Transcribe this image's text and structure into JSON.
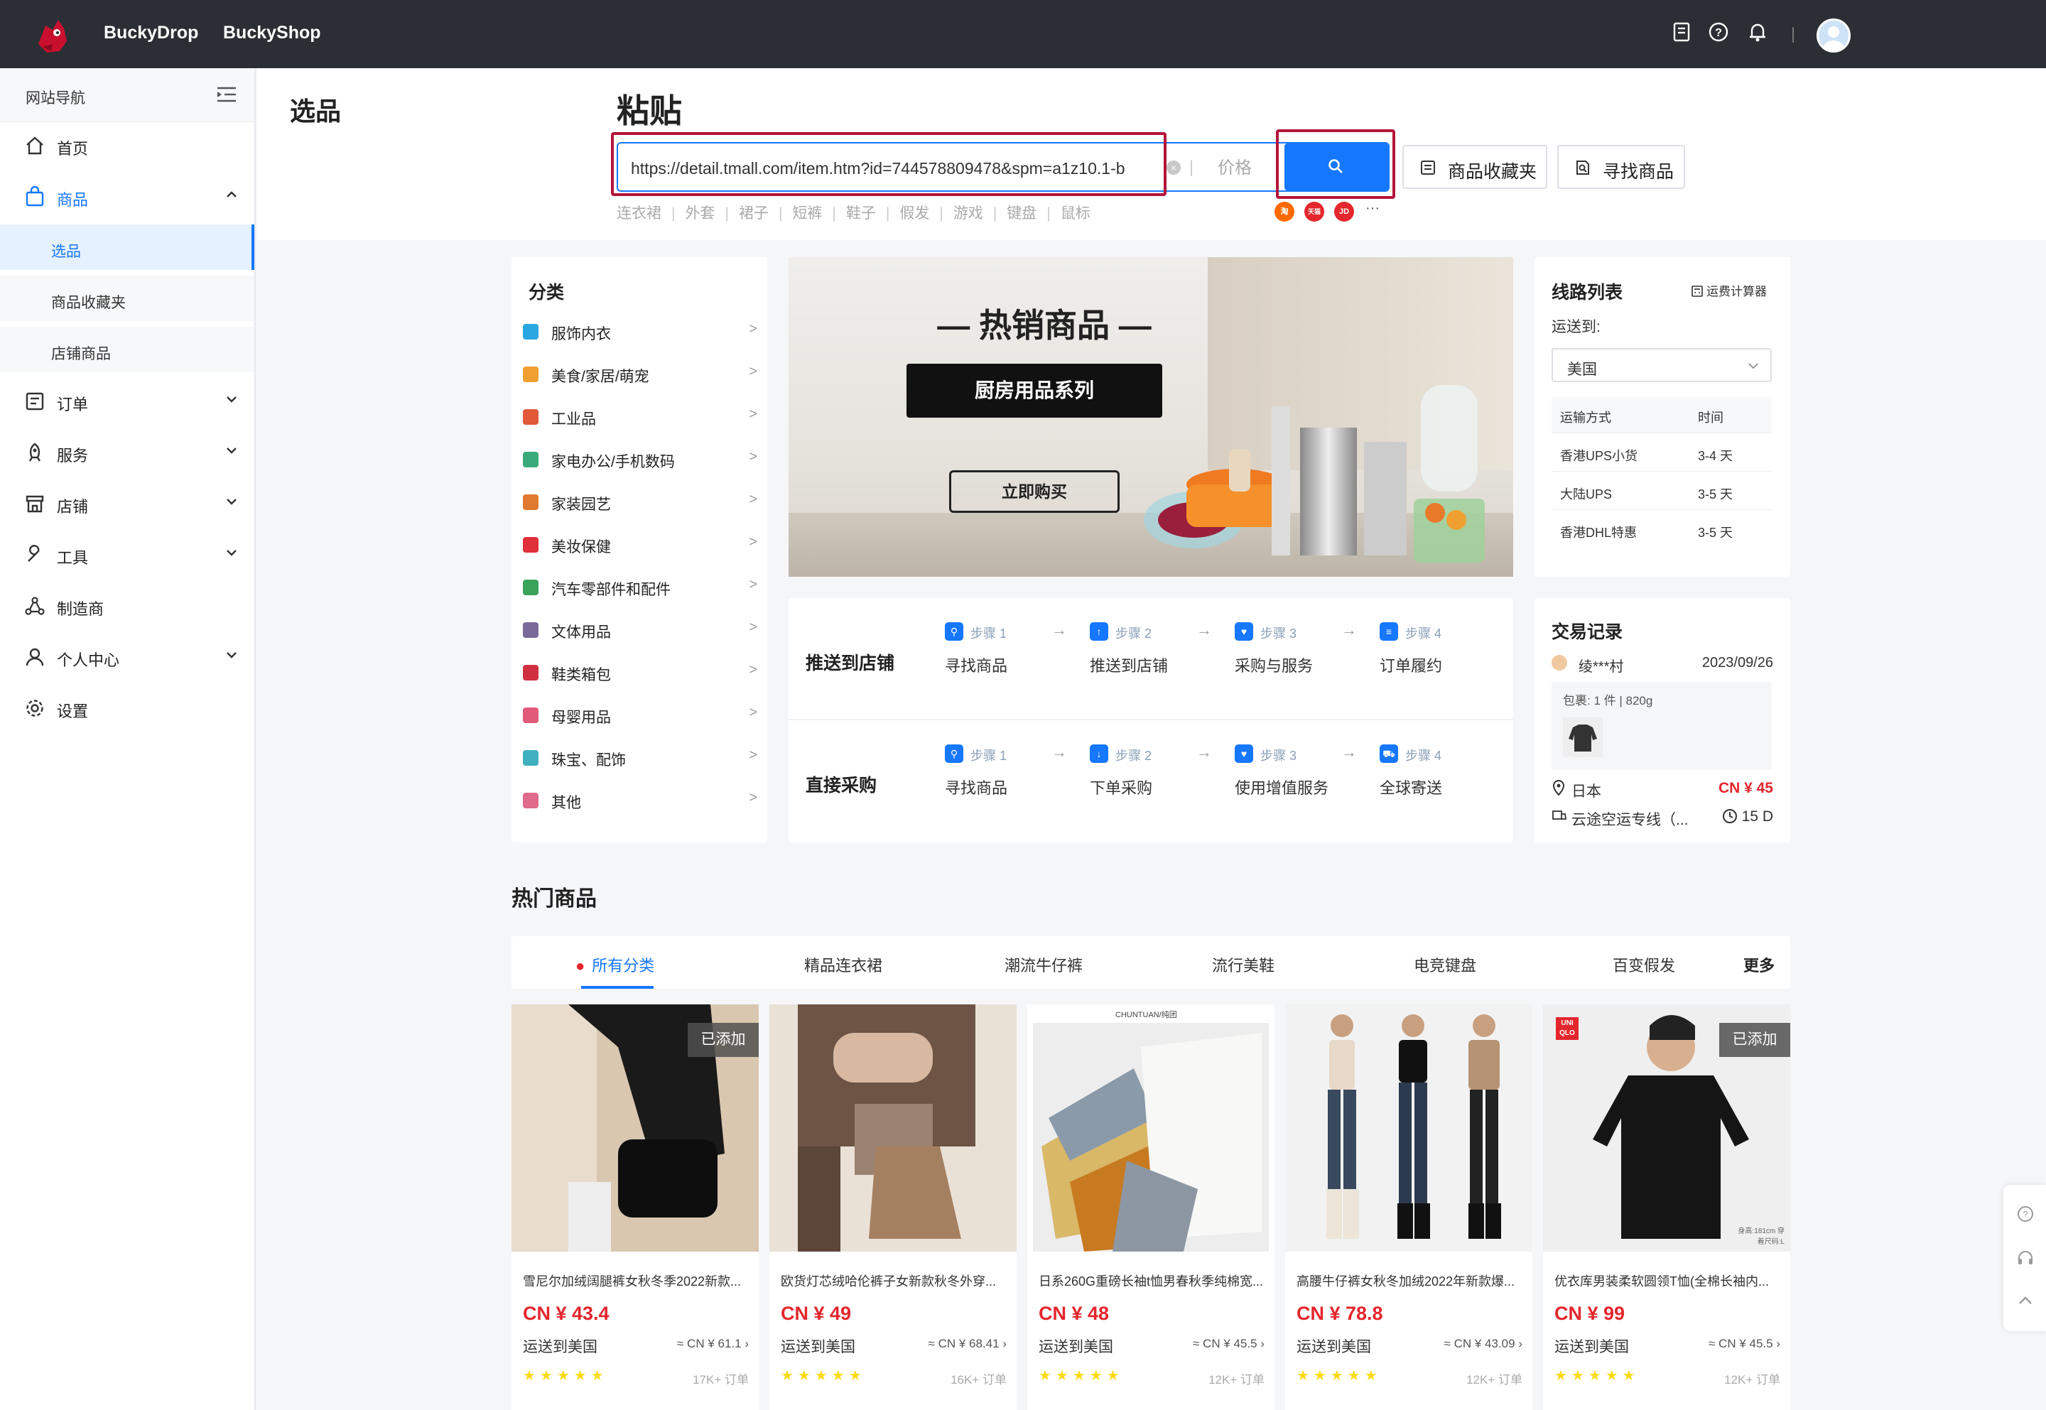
{
  "topbar": {
    "brands": [
      "BuckyDrop",
      "BuckyShop"
    ]
  },
  "sidebar": {
    "nav_title": "网站导航",
    "items": [
      {
        "label": "首页"
      },
      {
        "label": "商品"
      },
      {
        "label": "订单"
      },
      {
        "label": "服务"
      },
      {
        "label": "店铺"
      },
      {
        "label": "工具"
      },
      {
        "label": "制造商"
      },
      {
        "label": "个人中心"
      },
      {
        "label": "设置"
      }
    ],
    "sub_items": [
      {
        "label": "选品"
      },
      {
        "label": "商品收藏夹"
      },
      {
        "label": "店铺商品"
      }
    ]
  },
  "header": {
    "page_title": "选品",
    "paste_title": "粘贴",
    "url_value": "https://detail.tmall.com/item.htm?id=744578809478&spm=a1z10.1-b",
    "price_placeholder": "价格",
    "favorites_label": "商品收藏夹",
    "find_label": "寻找商品",
    "keywords": [
      "连衣裙",
      "外套",
      "裙子",
      "短裤",
      "鞋子",
      "假发",
      "游戏",
      "键盘",
      "鼠标"
    ],
    "keyword_sep": "|",
    "platforms": [
      "淘",
      "天猫",
      "JD"
    ],
    "more": "···"
  },
  "categories": {
    "title": "分类",
    "items": [
      {
        "label": "服饰内衣",
        "color": "#2aa7e0"
      },
      {
        "label": "美食/家居/萌宠",
        "color": "#f0a030"
      },
      {
        "label": "工业品",
        "color": "#e05a3a"
      },
      {
        "label": "家电办公/手机数码",
        "color": "#3aaa7a"
      },
      {
        "label": "家装园艺",
        "color": "#e07a30"
      },
      {
        "label": "美妆保健",
        "color": "#e0303a"
      },
      {
        "label": "汽车零部件和配件",
        "color": "#3aa35a"
      },
      {
        "label": "文体用品",
        "color": "#7a6a9a"
      },
      {
        "label": "鞋类箱包",
        "color": "#d03040"
      },
      {
        "label": "母婴用品",
        "color": "#e05a7a"
      },
      {
        "label": "珠宝、配饰",
        "color": "#40b0c0"
      },
      {
        "label": "其他",
        "color": "#e06a8a"
      }
    ],
    "arrow": ">"
  },
  "banner": {
    "title": "— 热销商品 —",
    "subtitle": "厨房用品系列",
    "button": "立即购买"
  },
  "route": {
    "title": "线路列表",
    "calc": "运费计算器",
    "ship_to_label": "运送到:",
    "country": "美国",
    "col_method": "运输方式",
    "col_time": "时间",
    "rows": [
      {
        "method": "香港UPS小货",
        "time": "3-4 天"
      },
      {
        "method": "大陆UPS",
        "time": "3-5 天"
      },
      {
        "method": "香港DHL特惠",
        "time": "3-5 天"
      }
    ]
  },
  "steps": {
    "rows": [
      {
        "label": "推送到店铺",
        "steps": [
          {
            "no": "步骤 1",
            "name": "寻找商品"
          },
          {
            "no": "步骤 2",
            "name": "推送到店铺"
          },
          {
            "no": "步骤 3",
            "name": "采购与服务"
          },
          {
            "no": "步骤 4",
            "name": "订单履约"
          }
        ]
      },
      {
        "label": "直接采购",
        "steps": [
          {
            "no": "步骤 1",
            "name": "寻找商品"
          },
          {
            "no": "步骤 2",
            "name": "下单采购"
          },
          {
            "no": "步骤 3",
            "name": "使用增值服务"
          },
          {
            "no": "步骤 4",
            "name": "全球寄送"
          }
        ]
      }
    ]
  },
  "trade": {
    "title": "交易记录",
    "user": "绫***村",
    "date": "2023/09/26",
    "package": "包裹: 1 件 | 820g",
    "country": "日本",
    "price": "CN ¥ 45",
    "line": "云途空运专线（...",
    "days": "15 D"
  },
  "hot": {
    "title": "热门商品",
    "tabs": [
      "所有分类",
      "精品连衣裙",
      "潮流牛仔裤",
      "流行美鞋",
      "电竞键盘",
      "百变假发",
      "更多"
    ],
    "products": [
      {
        "name": "雪尼尔加绒阔腿裤女秋冬季2022新款...",
        "price": "CN ¥ 43.4",
        "ship": "运送到美国",
        "ref": "≈ CN ¥ 61.1",
        "orders": "17K+ 订单",
        "added": "已添加",
        "rating": 4.5
      },
      {
        "name": "欧货灯芯绒哈伦裤子女新款秋冬外穿...",
        "price": "CN ¥ 49",
        "ship": "运送到美国",
        "ref": "≈ CN ¥ 68.41",
        "orders": "16K+ 订单",
        "added": "",
        "rating": 4.5
      },
      {
        "name": "日系260G重磅长袖t恤男春秋季纯棉宽...",
        "price": "CN ¥ 48",
        "ship": "运送到美国",
        "ref": "≈ CN ¥ 45.5",
        "orders": "12K+ 订单",
        "added": "",
        "rating": 4.5
      },
      {
        "name": "高腰牛仔裤女秋冬加绒2022年新款爆...",
        "price": "CN ¥ 78.8",
        "ship": "运送到美国",
        "ref": "≈ CN ¥ 43.09",
        "orders": "12K+ 订单",
        "added": "",
        "rating": 4.5
      },
      {
        "name": "优衣库男装柔软圆领T恤(全棉长袖内...",
        "price": "CN ¥ 99",
        "ship": "运送到美国",
        "ref": "≈ CN ¥ 45.5",
        "orders": "12K+ 订单",
        "added": "已添加",
        "rating": 4.5
      }
    ],
    "stars": "★★★★★",
    "img_text_3": "CHUNTUAN/纯团",
    "img_text_5": "UNI QLO",
    "img_caption_5": "身高:181cm 穿着尺码:L"
  },
  "colors": {
    "accent": "#1677ff",
    "price_red": "#e4262d",
    "highlight": "#b3143a",
    "topbar": "#2b2e35"
  }
}
